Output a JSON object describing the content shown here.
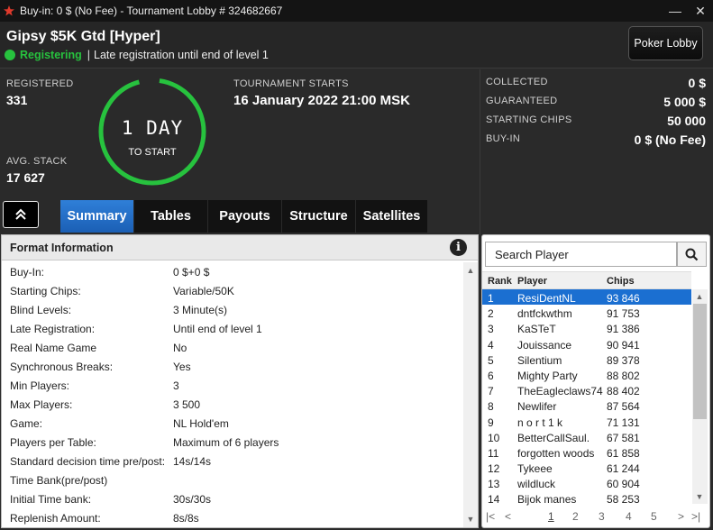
{
  "window": {
    "title": "Buy-in: 0 $ (No Fee) - Tournament Lobby # 324682667",
    "minimize": "—",
    "close": "✕"
  },
  "header": {
    "tournament_name": "Gipsy $5K Gtd [Hyper]",
    "status": "Registering",
    "separator": "|",
    "late_reg": "Late registration until end of level 1",
    "lobby_button": "Poker Lobby",
    "status_color": "#27c23e"
  },
  "stats": {
    "registered_label": "REGISTERED",
    "registered_value": "331",
    "avg_stack_label": "AVG. STACK",
    "avg_stack_value": "17 627",
    "countdown_big": "1 DAY",
    "countdown_small": "TO START",
    "starts_label": "TOURNAMENT STARTS",
    "starts_value": "16 January 2022  21:00 MSK"
  },
  "money": {
    "collected_label": "COLLECTED",
    "collected_value": "0 $",
    "guaranteed_label": "GUARANTEED",
    "guaranteed_value": "5 000 $",
    "starting_chips_label": "STARTING CHIPS",
    "starting_chips_value": "50 000",
    "buyin_label": "BUY-IN",
    "buyin_value": "0 $ (No Fee)"
  },
  "tabs": [
    "Summary",
    "Tables",
    "Payouts",
    "Structure",
    "Satellites"
  ],
  "format": {
    "title": "Format Information",
    "rows": [
      {
        "k": "Buy-In:",
        "v": "0 $+0 $"
      },
      {
        "k": "Starting Chips:",
        "v": "Variable/50K"
      },
      {
        "k": "Blind Levels:",
        "v": "3 Minute(s)"
      },
      {
        "k": "Late Registration:",
        "v": "Until end of level 1"
      },
      {
        "k": "Real Name Game",
        "v": "No"
      },
      {
        "k": "Synchronous Breaks:",
        "v": "Yes"
      },
      {
        "k": "Min Players:",
        "v": "3"
      },
      {
        "k": "Max Players:",
        "v": "3 500"
      },
      {
        "k": "Game:",
        "v": "NL Hold'em"
      },
      {
        "k": "Players per Table:",
        "v": "Maximum of 6 players"
      },
      {
        "k": "Standard decision time pre/post:",
        "v": "14s/14s"
      },
      {
        "k": "Time Bank(pre/post)",
        "v": ""
      },
      {
        "k": "Initial Time bank:",
        "v": "30s/30s"
      },
      {
        "k": "Replenish Amount:",
        "v": "8s/8s"
      }
    ]
  },
  "players": {
    "search_placeholder": "Search Player",
    "headers": {
      "rank": "Rank",
      "player": "Player",
      "chips": "Chips"
    },
    "rows": [
      {
        "rank": "1",
        "name": "ResiDentNL",
        "chips": "93 846"
      },
      {
        "rank": "2",
        "name": "dntfckwthm",
        "chips": "91 753"
      },
      {
        "rank": "3",
        "name": "KaSTeT",
        "chips": "91 386"
      },
      {
        "rank": "4",
        "name": "Jouissance",
        "chips": "90 941"
      },
      {
        "rank": "5",
        "name": "Silentium",
        "chips": "89 378"
      },
      {
        "rank": "6",
        "name": "Mighty Party",
        "chips": "88 802"
      },
      {
        "rank": "7",
        "name": "TheEagleclaws74",
        "chips": "88 402"
      },
      {
        "rank": "8",
        "name": "Newlifer",
        "chips": "87 564"
      },
      {
        "rank": "9",
        "name": "n o r t 1 k",
        "chips": "71 131"
      },
      {
        "rank": "10",
        "name": "BetterCallSaul.",
        "chips": "67 581"
      },
      {
        "rank": "11",
        "name": "forgotten woods",
        "chips": "61 858"
      },
      {
        "rank": "12",
        "name": "Tykeee",
        "chips": "61 244"
      },
      {
        "rank": "13",
        "name": "wildluck",
        "chips": "60 904"
      },
      {
        "rank": "14",
        "name": "Bijok manes",
        "chips": "58 253"
      }
    ],
    "pages": [
      "1",
      "2",
      "3",
      "4",
      "5"
    ]
  }
}
